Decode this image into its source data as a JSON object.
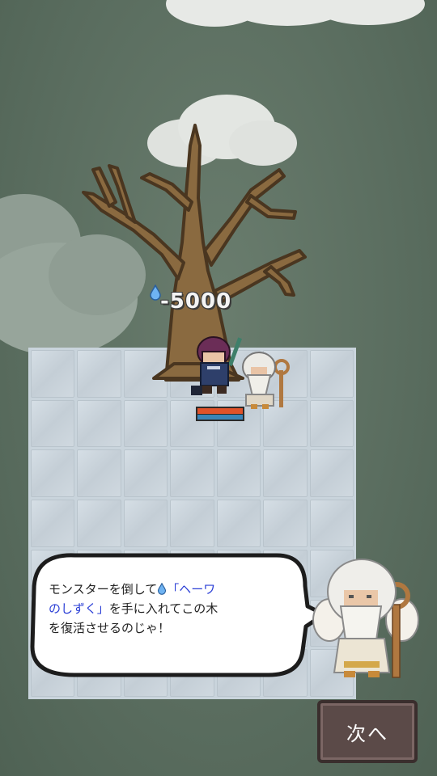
{
  "battle": {
    "damage_text": "-5000"
  },
  "dialog": {
    "line1_pre": "モンスターを倒して",
    "line1_item": "「ヘーワ",
    "line2_item": "のしずく」",
    "line2_post": "を手に入れてこの木",
    "line3": "を復活させるのじゃ！"
  },
  "buttons": {
    "next_label": "次へ"
  },
  "colors": {
    "accent_blue": "#2b3fd6",
    "button_bg": "#5b4a48",
    "floor": "#c9d4dc"
  },
  "icons": [
    "water-drop-icon",
    "water-drop-inline-icon"
  ]
}
